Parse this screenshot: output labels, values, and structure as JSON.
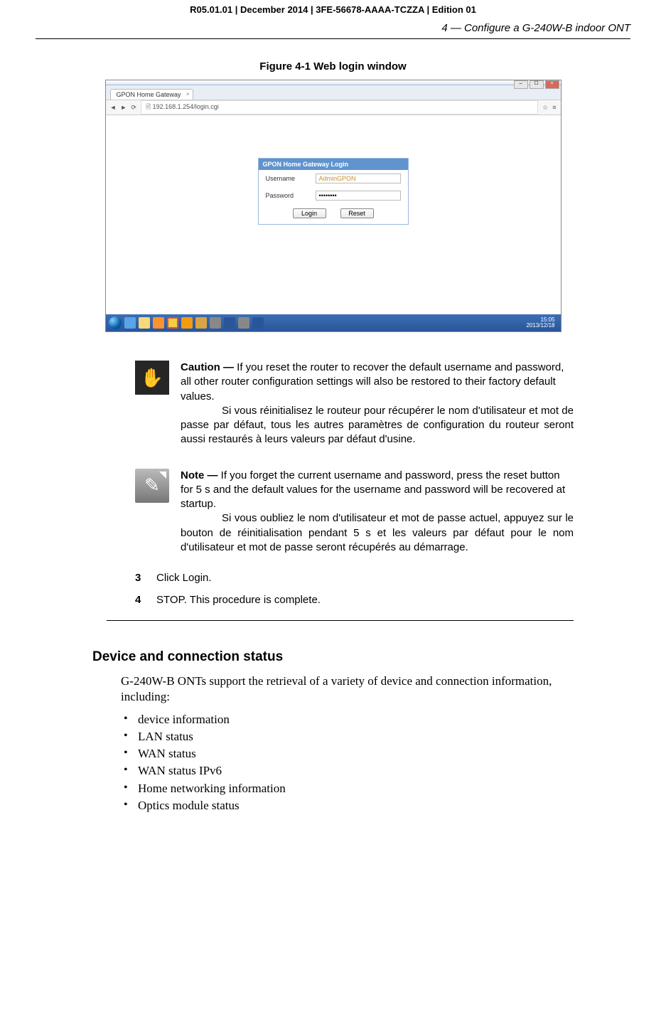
{
  "header": {
    "doc_info": "R05.01.01 | December 2014 | 3FE-56678-AAAA-TCZZA | Edition 01",
    "chapter": "4 —  Configure a G-240W-B indoor ONT"
  },
  "figure": {
    "caption": "Figure 4-1  Web login window"
  },
  "screenshot": {
    "tab_title": "GPON Home Gateway",
    "url": "192.168.1.254/login.cgi",
    "login_title": "GPON Home Gateway Login",
    "username_label": "Username",
    "username_value": "AdminGPON",
    "password_label": "Password",
    "password_value": "••••••••",
    "login_btn": "Login",
    "reset_btn": "Reset",
    "clock_time": "15:05",
    "clock_date": "2013/12/18"
  },
  "caution": {
    "lead": "Caution —  ",
    "en": "If you reset the router to recover the default username and password, all other router configuration settings will also be restored to their factory default values.",
    "fr": "Si vous réinitialisez le routeur pour récupérer le nom d'utilisateur et mot de passe par défaut, tous les autres paramètres de configuration du routeur seront aussi restaurés à leurs valeurs par défaut d'usine."
  },
  "note": {
    "lead": "Note —  ",
    "en": "If you forget the current username and password, press the reset button for 5 s and the default values for the username and password will be recovered at startup.",
    "fr": "Si vous oubliez le nom d'utilisateur et mot de passe actuel, appuyez sur le bouton de réinitialisation pendant 5 s et les valeurs par défaut pour le nom d'utilisateur et mot de passe seront récupérés au démarrage."
  },
  "steps": {
    "s3_num": "3",
    "s3_text": "Click Login.",
    "s4_num": "4",
    "s4_text": "STOP. This procedure is complete."
  },
  "section": {
    "heading": "Device and connection status",
    "intro": "G-240W-B ONTs support the retrieval of a variety of device and connection information, including:",
    "bullets": [
      "device information",
      "LAN status",
      "WAN status",
      "WAN status IPv6",
      "Home networking information",
      "Optics module status"
    ]
  }
}
